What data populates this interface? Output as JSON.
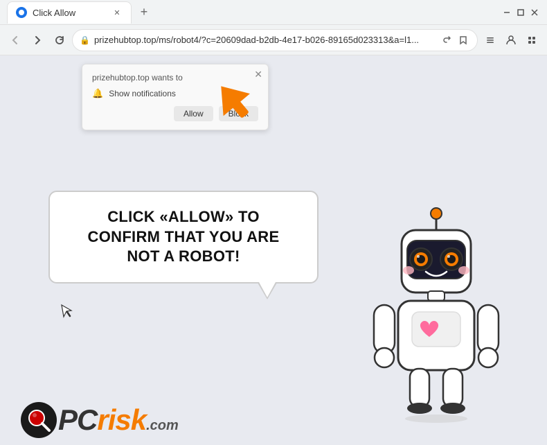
{
  "titlebar": {
    "tab_title": "Click Allow",
    "new_tab_label": "+"
  },
  "navbar": {
    "back_label": "←",
    "forward_label": "→",
    "reload_label": "↻",
    "address": "prizehubtop.top/ms/robot4/?c=20609dad-b2db-4e17-b026-89165d023313&a=l1...",
    "lock_icon": "🔒"
  },
  "window_controls": {
    "minimize": "—",
    "maximize": "□",
    "close": "✕"
  },
  "notification_popup": {
    "domain": "prizehubtop.top wants to",
    "bell_text": "Show notifications",
    "allow_label": "Allow",
    "block_label": "Block"
  },
  "speech_bubble": {
    "text": "CLICK «ALLOW» TO CONFIRM THAT YOU ARE NOT A ROBOT!"
  },
  "pcrisk": {
    "pc": "PC",
    "risk": "risk",
    "dotcom": ".com"
  }
}
